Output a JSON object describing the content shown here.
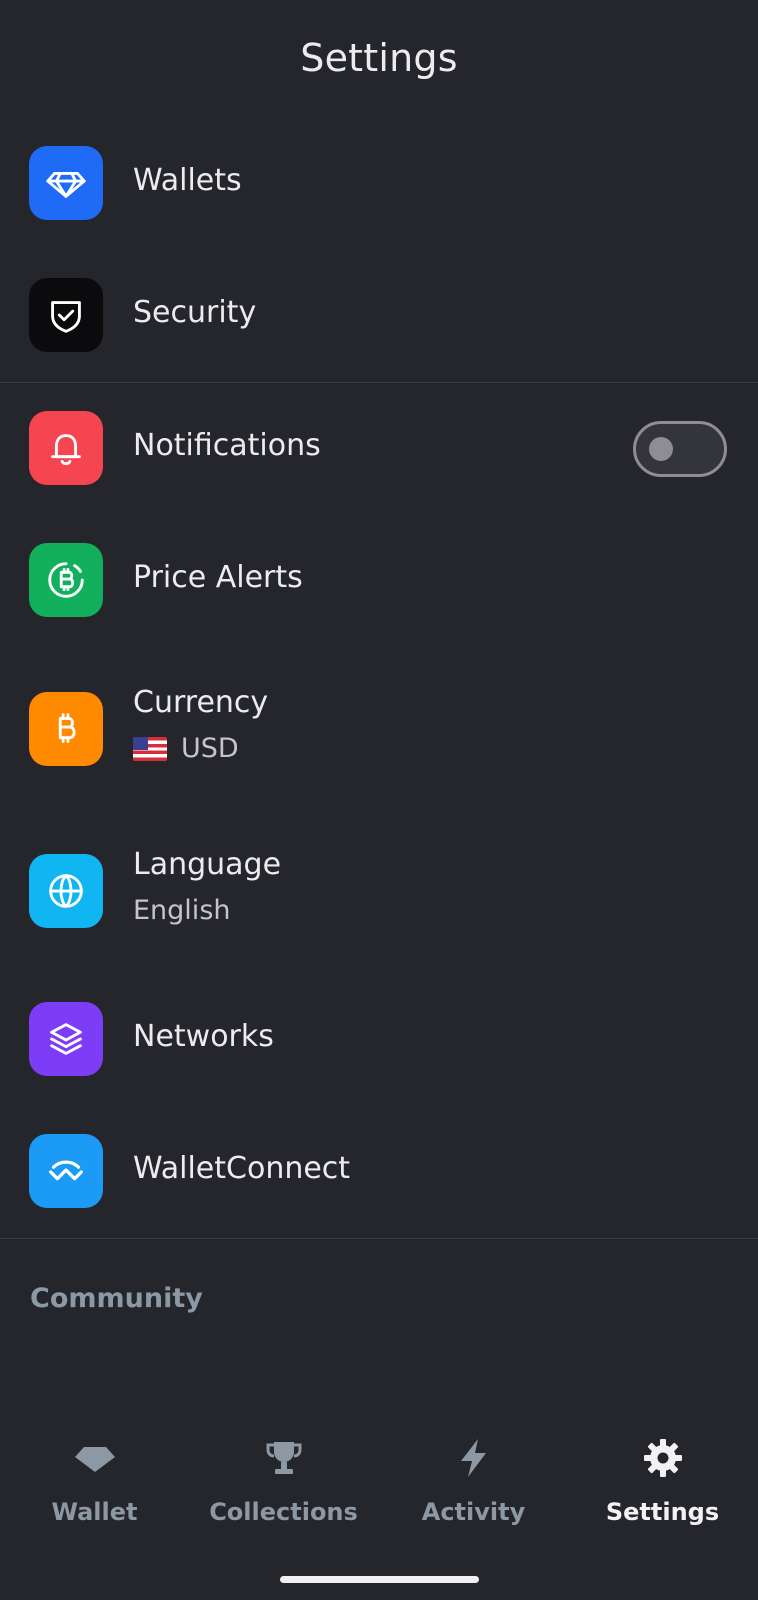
{
  "header": {
    "title": "Settings"
  },
  "settings": {
    "wallets": {
      "label": "Wallets",
      "icon": "diamond-icon",
      "color": "#1f6bf5"
    },
    "security": {
      "label": "Security",
      "icon": "shield-check-icon",
      "color": "#0b0b0d"
    },
    "notifications": {
      "label": "Notifications",
      "icon": "bell-icon",
      "color": "#f44551",
      "enabled": false
    },
    "price_alerts": {
      "label": "Price Alerts",
      "icon": "bitcoin-alert-icon",
      "color": "#12b05c"
    },
    "currency": {
      "label": "Currency",
      "value": "USD",
      "flag": "us-flag-icon",
      "icon": "bitcoin-icon",
      "color": "#ff8a00"
    },
    "language": {
      "label": "Language",
      "value": "English",
      "icon": "globe-icon",
      "color": "#0fb6f2"
    },
    "networks": {
      "label": "Networks",
      "icon": "layers-icon",
      "color": "#7d3cf6"
    },
    "walletconnect": {
      "label": "WalletConnect",
      "icon": "walletconnect-icon",
      "color": "#1b9bf5"
    }
  },
  "community": {
    "title": "Community"
  },
  "tabbar": {
    "tabs": [
      {
        "label": "Wallet",
        "icon": "diamond-icon",
        "active": false
      },
      {
        "label": "Collections",
        "icon": "trophy-icon",
        "active": false
      },
      {
        "label": "Activity",
        "icon": "lightning-icon",
        "active": false
      },
      {
        "label": "Settings",
        "icon": "gear-icon",
        "active": true
      }
    ],
    "inactive_color": "#8c98a4",
    "active_color": "#f2f2f5"
  }
}
